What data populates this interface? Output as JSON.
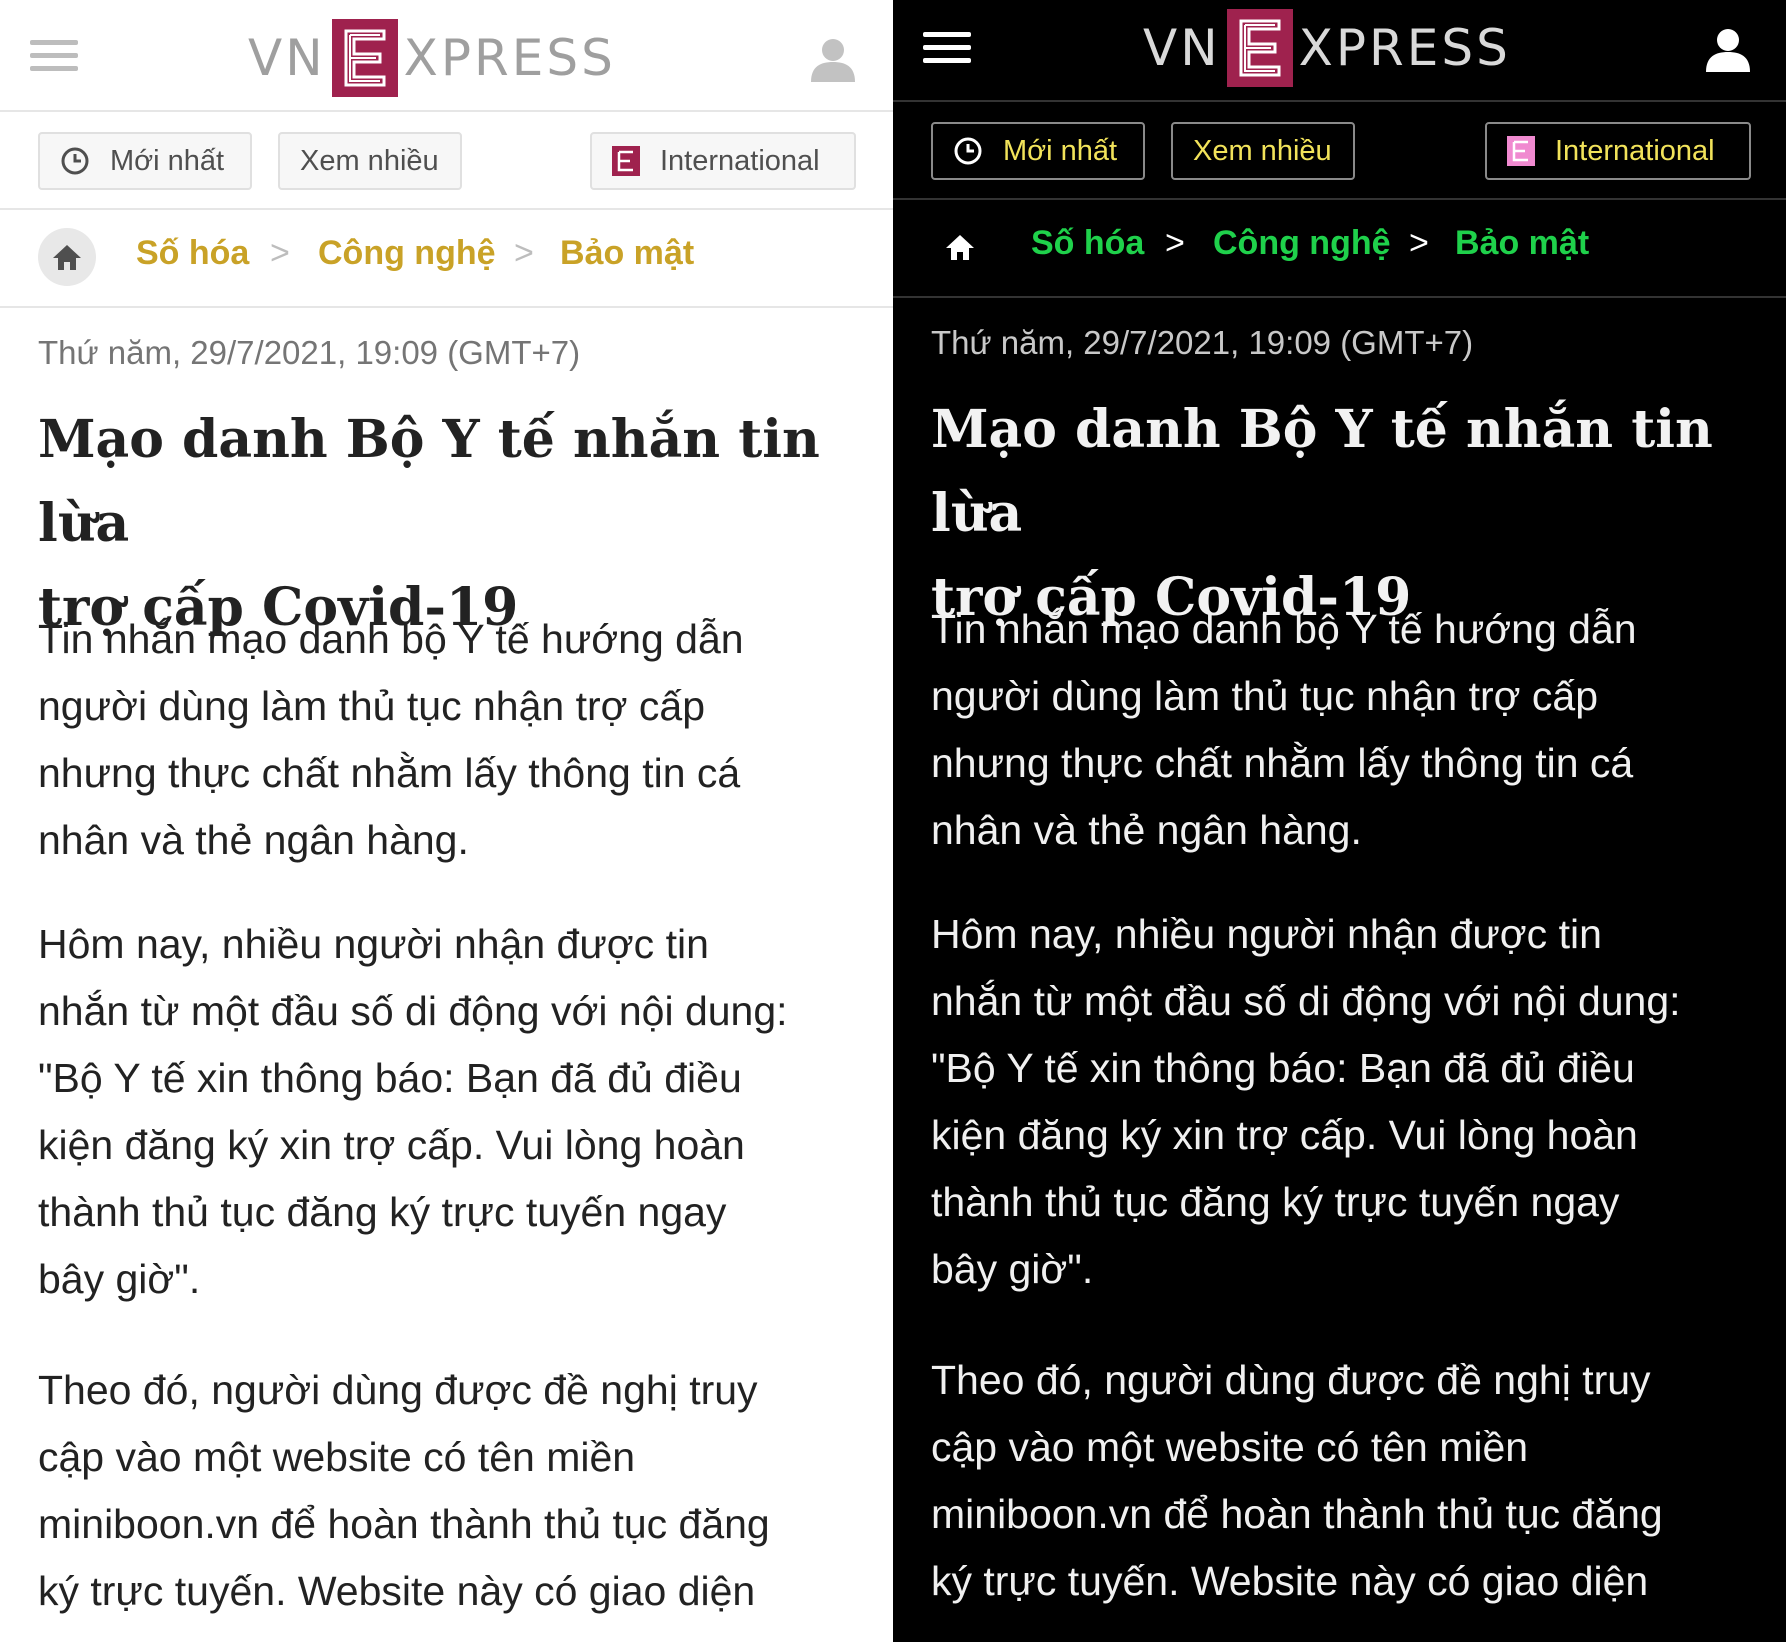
{
  "logo": {
    "vn": "VN",
    "e": "E",
    "xpress": "XPRESS"
  },
  "nav": {
    "newest": "Mới nhất",
    "most_viewed": "Xem nhiều",
    "international": "International"
  },
  "breadcrumb": [
    "Số hóa",
    "Công nghệ",
    "Bảo mật"
  ],
  "breadcrumb_separator": ">",
  "article": {
    "date": "Thứ năm, 29/7/2021, 19:09 (GMT+7)",
    "title_line1": "Mạo danh Bộ Y tế nhắn tin lừa",
    "title_line2": "trợ cấp Covid-19",
    "p1": [
      "Tin nhắn mạo danh bộ Y tế hướng dẫn",
      "người dùng làm thủ tục nhận trợ cấp",
      "nhưng thực chất nhằm lấy thông tin cá",
      "nhân và thẻ ngân hàng."
    ],
    "p2": [
      "Hôm nay, nhiều người nhận được tin",
      "nhắn từ một đầu số di động với nội dung:",
      "\"Bộ Y tế xin thông báo: Bạn đã đủ điều",
      "kiện đăng ký xin trợ cấp. Vui lòng hoàn",
      "thành thủ tục đăng ký trực tuyến ngay",
      "bây giờ\"."
    ],
    "p3": [
      "Theo đó, người dùng được đề nghị truy",
      "cập vào một website có tên miền",
      "miniboon.vn để hoàn thành thủ tục đăng",
      "ký trực tuyến. Website này có giao diện"
    ]
  },
  "icons": {
    "menu": "hamburger-icon",
    "user": "user-icon",
    "clock": "clock-icon",
    "intl": "e-logo-icon",
    "home": "home-icon"
  },
  "colors": {
    "brand": "#9f224e",
    "light_breadcrumb": "#c9a227",
    "dark_breadcrumb": "#1fd14b",
    "dark_nav_text": "#f2e35a"
  }
}
